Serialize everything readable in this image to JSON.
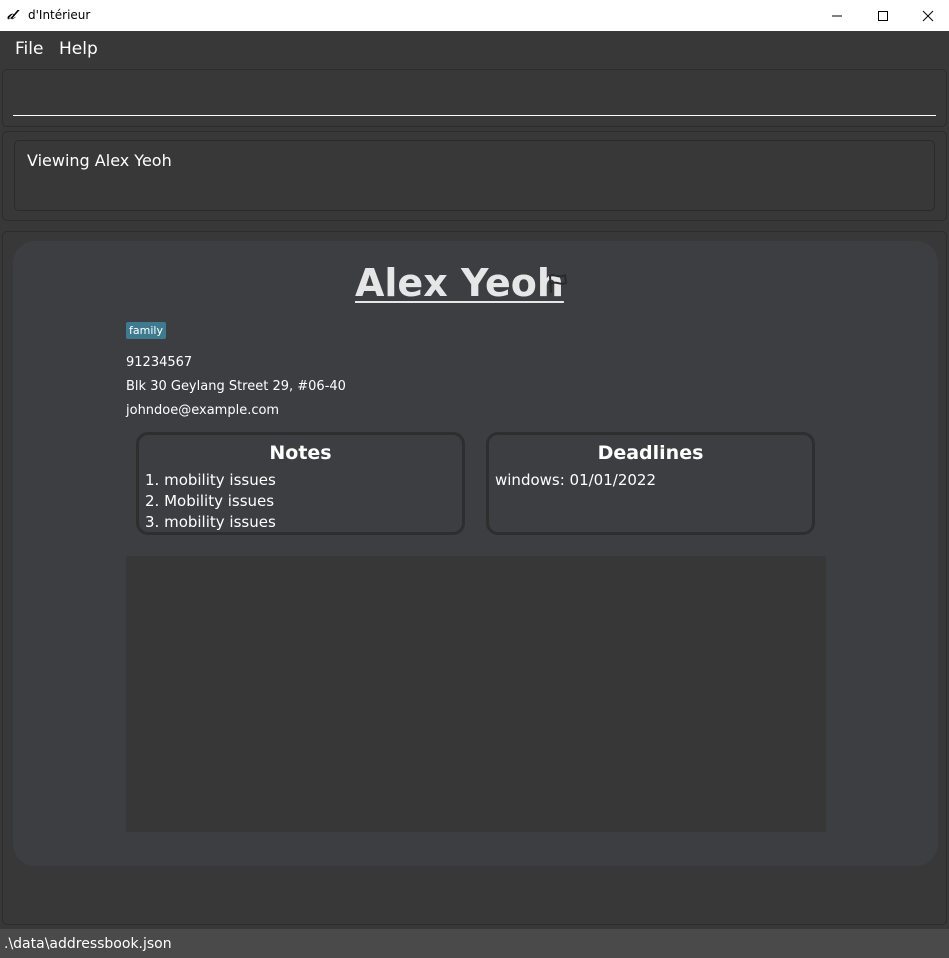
{
  "window": {
    "title": "d'Intérieur",
    "app_icon": "script-d-logo",
    "controls": [
      "minimize-icon",
      "maximize-icon",
      "close-icon"
    ]
  },
  "menu": {
    "items": [
      "File",
      "Help"
    ]
  },
  "command_box": {
    "value": "",
    "placeholder": ""
  },
  "result_display": {
    "text": "Viewing Alex Yeoh"
  },
  "person": {
    "name": "Alex Yeoh",
    "flag_icon": "flag-icon",
    "tags": [
      "family"
    ],
    "phone": "91234567",
    "address": "Blk 30 Geylang Street 29, #06-40",
    "email": "johndoe@example.com",
    "notes": {
      "title": "Notes",
      "items": [
        "1. mobility issues",
        "2. Mobility issues",
        "3. mobility issues"
      ]
    },
    "deadlines": {
      "title": "Deadlines",
      "items": [
        "windows: 01/01/2022"
      ]
    }
  },
  "status_bar": {
    "path": ".\\data\\addressbook.json"
  },
  "colors": {
    "background": "#383838",
    "card": "#3c3e41",
    "tag": "#3e7b91",
    "status_bar": "#4a4a4a"
  }
}
